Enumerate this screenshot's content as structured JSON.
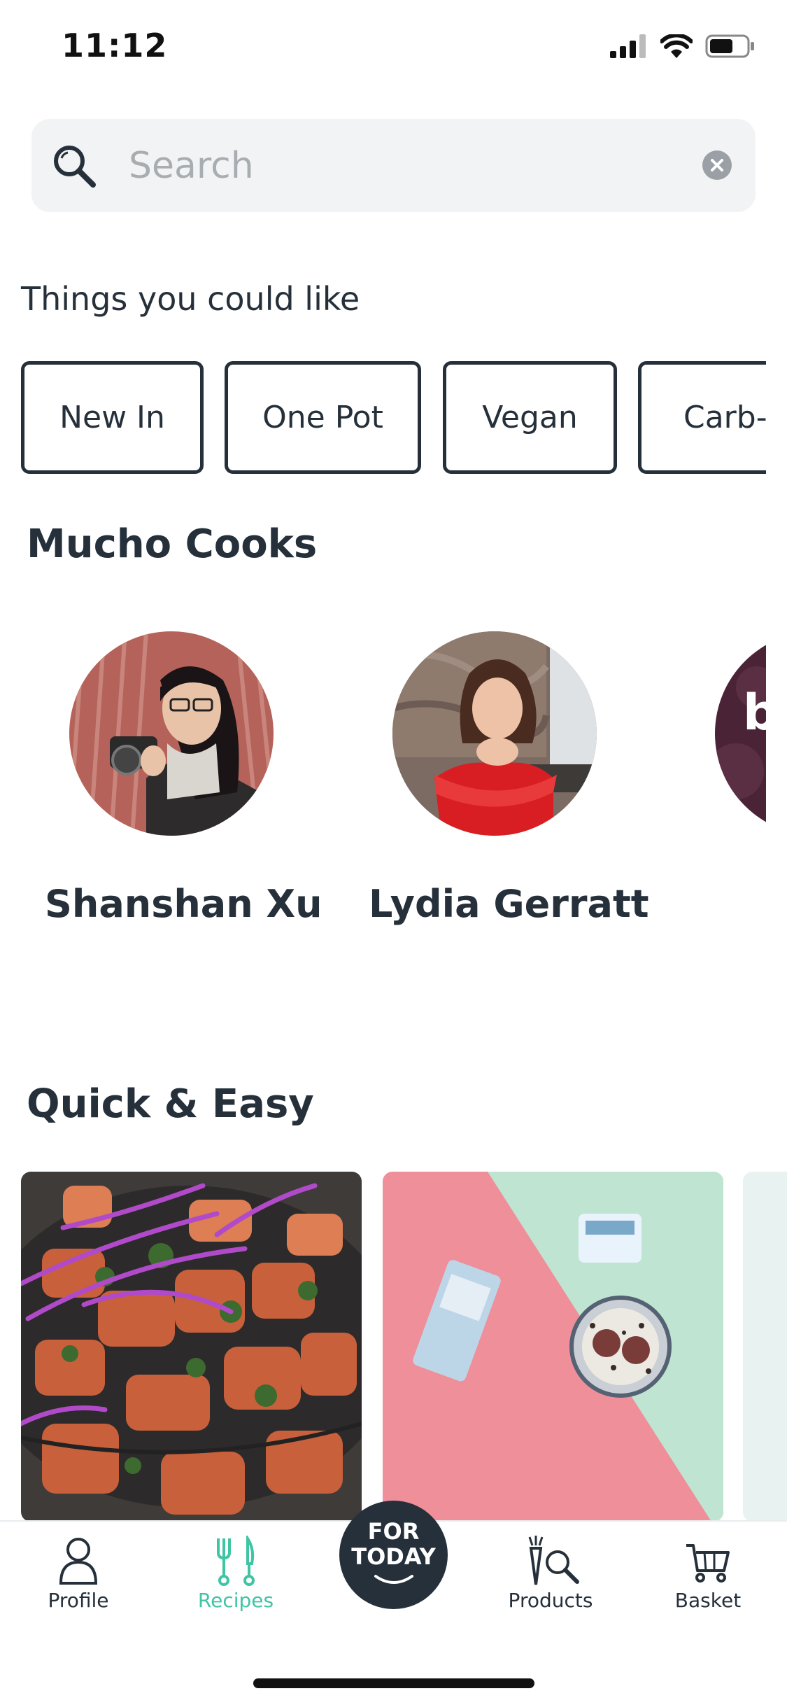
{
  "status_bar": {
    "time": "11:12"
  },
  "search": {
    "placeholder": "Search",
    "value": ""
  },
  "suggestions": {
    "title": "Things you could like",
    "chips": [
      {
        "label": "New In"
      },
      {
        "label": "One Pot"
      },
      {
        "label": "Vegan"
      },
      {
        "label": "Carb-"
      }
    ]
  },
  "cooks": {
    "title": "Mucho Cooks",
    "items": [
      {
        "name": "Shanshan Xu"
      },
      {
        "name": "Lydia Gerratt"
      }
    ]
  },
  "quick_easy": {
    "title": "Quick & Easy"
  },
  "tab_bar": {
    "items": [
      {
        "label": "Profile",
        "icon": "person-icon"
      },
      {
        "label": "Recipes",
        "icon": "fork-knife-icon",
        "active": true
      },
      {
        "label": "FOR TODAY",
        "line1": "FOR",
        "line2": "TODAY"
      },
      {
        "label": "Products",
        "icon": "carrot-search-icon"
      },
      {
        "label": "Basket",
        "icon": "cart-icon"
      }
    ]
  },
  "colors": {
    "accent": "#3fc4a4",
    "text": "#25303a",
    "search_bg": "#f2f3f4"
  }
}
